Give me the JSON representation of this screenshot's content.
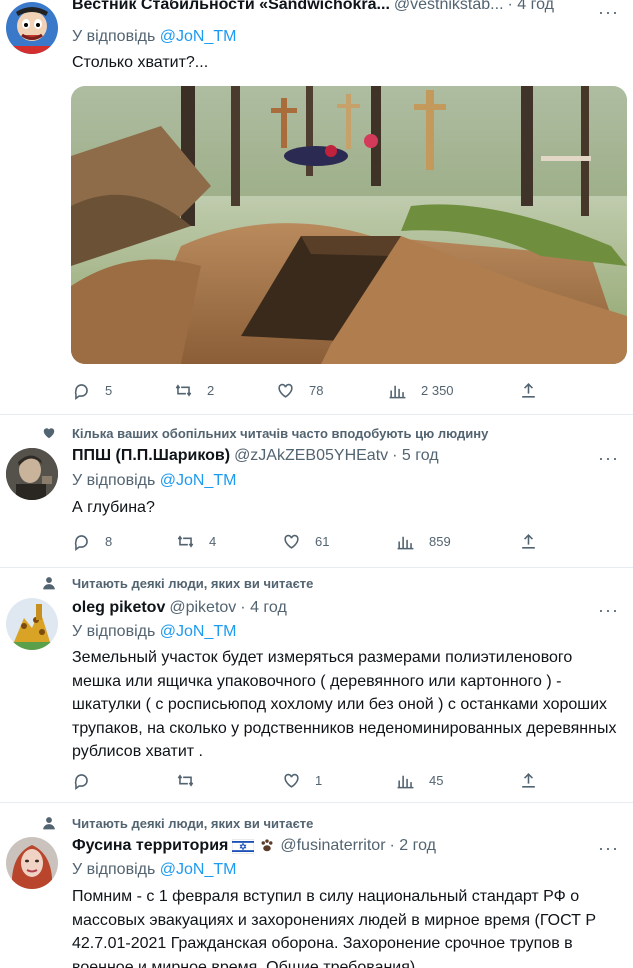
{
  "tweets": [
    {
      "author_name": "Вестник Стабильности «Sandwichokra...",
      "handle": "@vestnikstab...",
      "time": "· 4 год",
      "reply_label": "У відповідь",
      "reply_to": "@JoN_TM",
      "text": "Столько хватит?...",
      "actions": {
        "replies": "5",
        "retweets": "2",
        "likes": "78",
        "views": "2 350"
      }
    },
    {
      "social_context": "Кілька ваших обопільних читачів часто вподобують цю людину",
      "author_name": "ППШ (П.П.Шариков)",
      "handle": "@zJAkZEB05YHEatv",
      "time": "· 5 год",
      "reply_label": "У відповідь",
      "reply_to": "@JoN_TM",
      "text": "А глубина?",
      "actions": {
        "replies": "8",
        "retweets": "4",
        "likes": "61",
        "views": "859"
      }
    },
    {
      "social_context": "Читають деякі люди, яких ви читаєте",
      "author_name": "oleg piketov",
      "handle": "@piketov",
      "time": "· 4 год",
      "reply_label": "У відповідь",
      "reply_to": "@JoN_TM",
      "text": "Земельный участок будет измеряться размерами полиэтиленового мешка или ящичка упаковочного  ( деревянного или картонного ) - шкатулки ( с росписьюпод хохлому или без оной )  с останками хороших трупаков,  на сколько у родственников неденоминированных деревянных рублисов хватит .",
      "actions": {
        "replies": "",
        "retweets": "",
        "likes": "1",
        "views": "45"
      }
    },
    {
      "social_context": "Читають деякі люди, яких ви читаєте",
      "author_name": "Фусина территория",
      "handle": "@fusinaterritor",
      "time": "· 2 год",
      "reply_label": "У відповідь",
      "reply_to": "@JoN_TM",
      "text": "Помним -  с 1 февраля вступил в силу национальный стандарт РФ о массовых эвакуациях и захоронениях людей в мирное время (ГОСТ Р 42.7.01-2021 Гражданская оборона. Захоронение срочное трупов в военное и мирное время. Общие требования)."
    }
  ],
  "icons": {
    "reply": "reply-icon",
    "retweet": "retweet-icon",
    "like": "like-icon",
    "views": "views-icon",
    "share": "share-icon",
    "more": "more-icon"
  },
  "colors": {
    "link": "#1d9bf0",
    "muted": "#536471",
    "text": "#0f1419"
  }
}
